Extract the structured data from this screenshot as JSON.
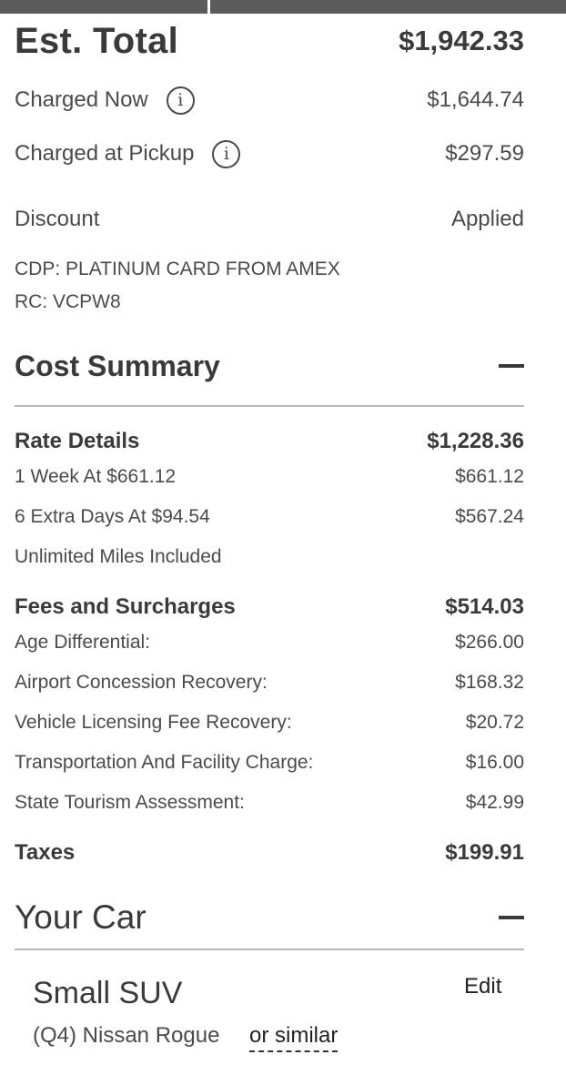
{
  "summary": {
    "est_total_label": "Est. Total",
    "est_total_value": "$1,942.33",
    "charged_now_label": "Charged Now",
    "charged_now_value": "$1,644.74",
    "charged_pickup_label": "Charged at Pickup",
    "charged_pickup_value": "$297.59",
    "info_glyph": "i",
    "discount_label": "Discount",
    "discount_value": "Applied",
    "cdp_line": "CDP: PLATINUM CARD FROM AMEX",
    "rc_line": "RC: VCPW8"
  },
  "cost_summary": {
    "title": "Cost Summary",
    "rate_details": {
      "label": "Rate Details",
      "total": "$1,228.36",
      "items": [
        {
          "label": "1 Week At $661.12",
          "value": "$661.12"
        },
        {
          "label": "6 Extra Days At $94.54",
          "value": "$567.24"
        }
      ],
      "note": "Unlimited Miles Included"
    },
    "fees": {
      "label": "Fees and Surcharges",
      "total": "$514.03",
      "items": [
        {
          "label": "Age Differential:",
          "value": "$266.00"
        },
        {
          "label": "Airport Concession Recovery:",
          "value": "$168.32"
        },
        {
          "label": "Vehicle Licensing Fee Recovery:",
          "value": "$20.72"
        },
        {
          "label": "Transportation And Facility Charge:",
          "value": "$16.00"
        },
        {
          "label": "State Tourism Assessment:",
          "value": "$42.99"
        }
      ]
    },
    "taxes": {
      "label": "Taxes",
      "total": "$199.91"
    }
  },
  "your_car": {
    "title": "Your Car",
    "car_class": "Small SUV",
    "edit_label": "Edit",
    "model": "(Q4) Nissan Rogue",
    "or_similar": "or similar"
  },
  "colors": {
    "text": "#3a3a3a",
    "rule": "#b8b8b8",
    "topbar": "#5c5c5c"
  }
}
